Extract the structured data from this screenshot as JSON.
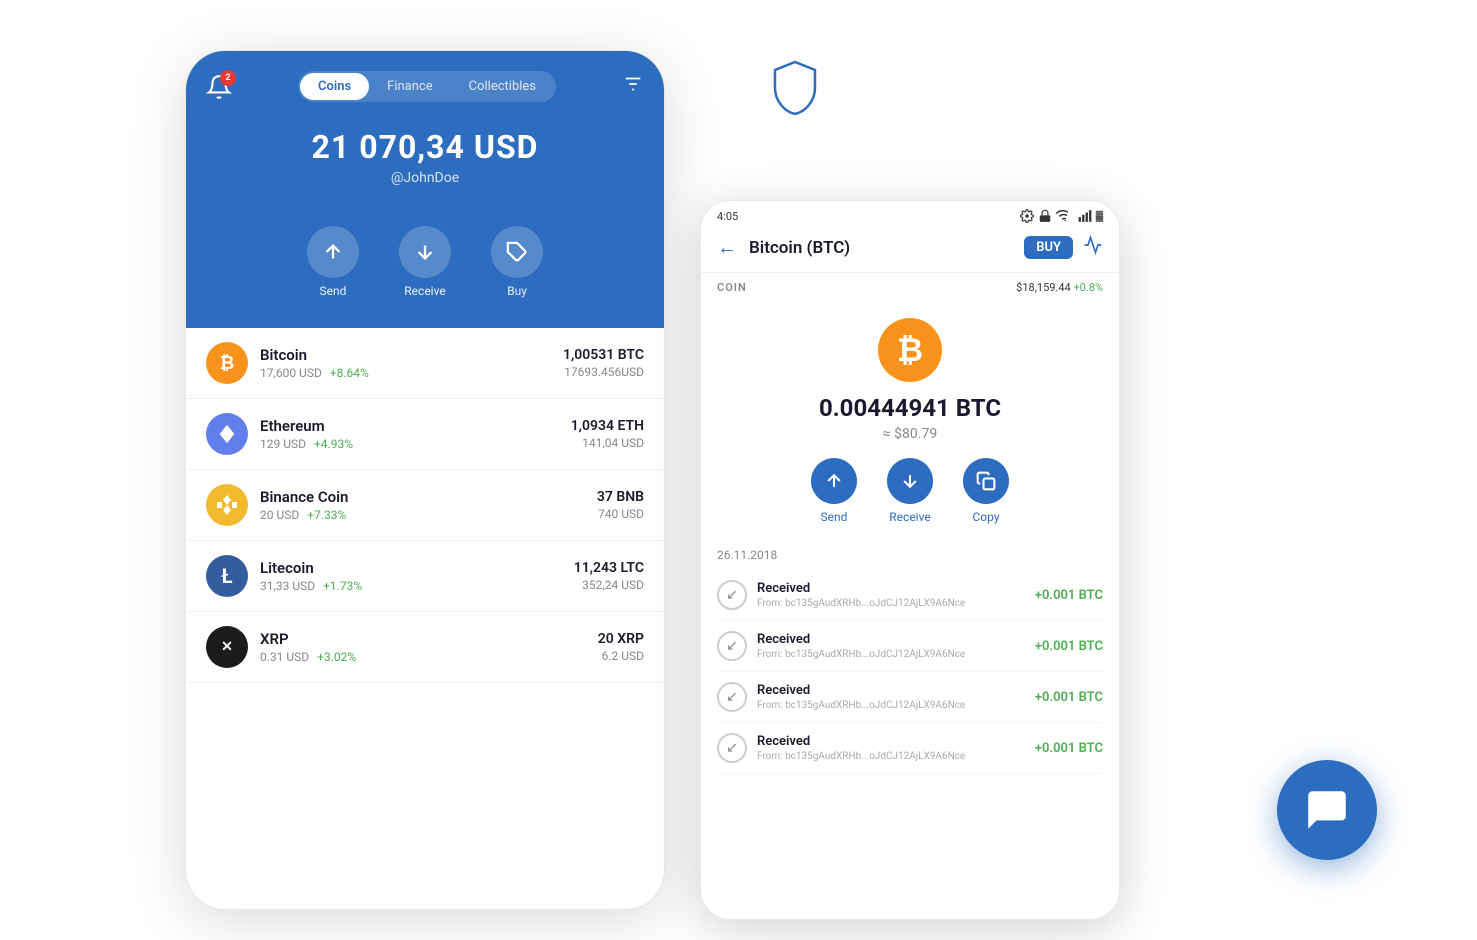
{
  "shield": {
    "aria": "shield-icon"
  },
  "phone_left": {
    "notification_count": "2",
    "tabs": [
      "Coins",
      "Finance",
      "Collectibles"
    ],
    "active_tab": "Coins",
    "balance": "21 070,34 USD",
    "username": "@JohnDoe",
    "actions": [
      "Send",
      "Receive",
      "Buy"
    ],
    "coins": [
      {
        "name": "Bitcoin",
        "symbol": "BTC",
        "price": "17,600 USD",
        "change": "+8.64%",
        "amount": "1,00531 BTC",
        "value": "17693.456USD",
        "logo_type": "btc"
      },
      {
        "name": "Ethereum",
        "symbol": "ETH",
        "price": "129 USD",
        "change": "+4.93%",
        "amount": "1,0934 ETH",
        "value": "141,04 USD",
        "logo_type": "eth"
      },
      {
        "name": "Binance Coin",
        "symbol": "BNB",
        "price": "20 USD",
        "change": "+7.33%",
        "amount": "37 BNB",
        "value": "740 USD",
        "logo_type": "bnb"
      },
      {
        "name": "Litecoin",
        "symbol": "LTC",
        "price": "31,33 USD",
        "change": "+1.73%",
        "amount": "11,243 LTC",
        "value": "352,24 USD",
        "logo_type": "ltc"
      },
      {
        "name": "XRP",
        "symbol": "XRP",
        "price": "0.31 USD",
        "change": "+3.02%",
        "amount": "20 XRP",
        "value": "6.2 USD",
        "logo_type": "xrp"
      }
    ]
  },
  "phone_right": {
    "status_time": "4:05",
    "title": "Bitcoin (BTC)",
    "buy_label": "BUY",
    "coin_label": "COIN",
    "coin_price": "$18,159.44 +0.8%",
    "btc_balance": "0.00444941 BTC",
    "btc_usd": "≈ $80.79",
    "actions": [
      "Send",
      "Receive",
      "Copy"
    ],
    "tx_date": "26.11.2018",
    "transactions": [
      {
        "type": "Received",
        "from": "From: bc135gAudXRHb...oJdCJ12AjLX9A6Nce",
        "amount": "+0.001 BTC"
      },
      {
        "type": "Received",
        "from": "From: bc135gAudXRHb...oJdCJ12AjLX9A6Nce",
        "amount": "+0.001 BTC"
      },
      {
        "type": "Received",
        "from": "From: bc135gAudXRHb...oJdCJ12AjLX9A6Nce",
        "amount": "+0.001 BTC"
      },
      {
        "type": "Received",
        "from": "From: bc135gAudXRHb...oJdCJ12AjLX9A6Nce",
        "amount": "+0.001 BTC"
      }
    ]
  },
  "chat_bubble": {
    "aria": "chat-icon"
  }
}
